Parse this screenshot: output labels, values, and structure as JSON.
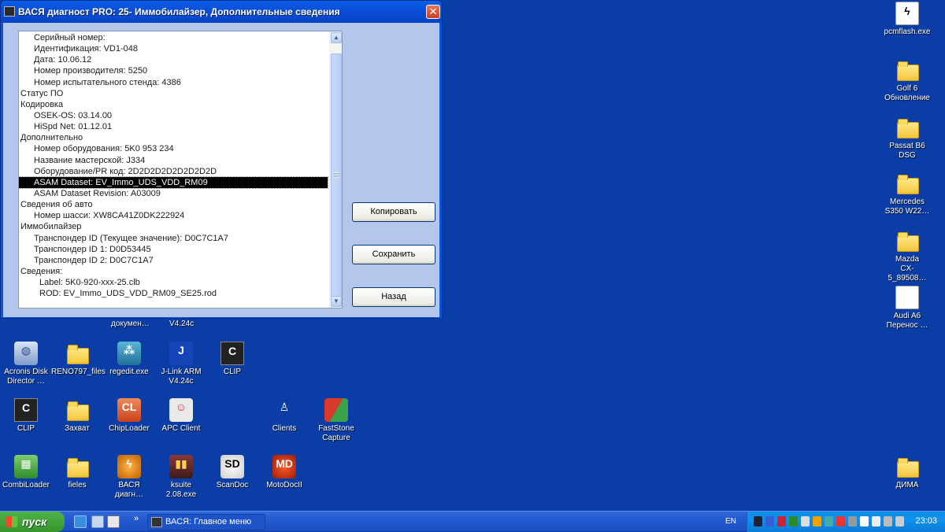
{
  "window": {
    "title": "ВАСЯ диагност PRO: 25- Иммобилайзер,  Дополнительные сведения",
    "close_glyph": "✕",
    "list_items": [
      {
        "text": "Серийный номер:",
        "indent": 1
      },
      {
        "text": "Идентификация: VD1-048",
        "indent": 1
      },
      {
        "text": "Дата: 10.06.12",
        "indent": 1
      },
      {
        "text": "Номер производителя: 5250",
        "indent": 1
      },
      {
        "text": "Номер испытательного стенда: 4386",
        "indent": 1
      },
      {
        "text": "Статус ПО",
        "indent": 0
      },
      {
        "text": "Кодировка",
        "indent": 0
      },
      {
        "text": "OSEK-OS: 03.14.00",
        "indent": 1
      },
      {
        "text": "HiSpd Net: 01.12.01",
        "indent": 1
      },
      {
        "text": "Дополнительно",
        "indent": 0
      },
      {
        "text": "Номер оборудования: 5K0 953 234",
        "indent": 1
      },
      {
        "text": "Название мастерской: J334",
        "indent": 1
      },
      {
        "text": "Оборудование/PR код: 2D2D2D2D2D2D2D2D",
        "indent": 1
      },
      {
        "text": "ASAM Dataset: EV_Immo_UDS_VDD_RM09",
        "indent": 1,
        "selected": true
      },
      {
        "text": "ASAM Dataset Revision: A03009",
        "indent": 1
      },
      {
        "text": "Сведения об авто",
        "indent": 0
      },
      {
        "text": "Номер шасси: XW8CA41Z0DK222924",
        "indent": 1
      },
      {
        "text": "Иммобилайзер",
        "indent": 0
      },
      {
        "text": "Транспондер ID (Текущее значение): D0C7C1A7",
        "indent": 1
      },
      {
        "text": "Транспондер ID 1: D0D53445",
        "indent": 1
      },
      {
        "text": "Транспондер ID 2: D0C7C1A7",
        "indent": 1
      },
      {
        "text": "Сведения:",
        "indent": 0
      },
      {
        "text": "Label: 5K0-920-xxx-25.clb",
        "indent": 2
      },
      {
        "text": "ROD: EV_Immo_UDS_VDD_RM09_SE25.rod",
        "indent": 2
      }
    ],
    "buttons": {
      "copy": "Копировать",
      "save": "Сохранить",
      "back": "Назад"
    }
  },
  "desktop": {
    "partial_labels": {
      "docs": "докумен…",
      "jlink_ver": "V4.24c"
    },
    "right_icons": [
      {
        "label": "pcmflash.exe",
        "icon": "pcmflash-icon"
      },
      {
        "label": "Golf 6\nОбновление",
        "icon": "folder-icon"
      },
      {
        "label": "Passat B6 DSG",
        "icon": "folder-icon"
      },
      {
        "label": "Mercedes\nS350 W22…",
        "icon": "folder-icon"
      },
      {
        "label": "Mazda\nCX-5_89508…",
        "icon": "folder-icon"
      },
      {
        "label": "Audi A6\nПеренос …",
        "icon": "document-icon"
      },
      {
        "label": "ДИМА",
        "icon": "folder-icon"
      }
    ],
    "grid_icons": [
      {
        "label": "Acronis Disk\nDirector …",
        "icon": "acronis-icon"
      },
      {
        "label": "RENO797_files",
        "icon": "folder-icon"
      },
      {
        "label": "regedit.exe",
        "icon": "regedit-icon"
      },
      {
        "label": "J-Link ARM\nV4.24c",
        "icon": "jlink-icon"
      },
      {
        "label": "CLIP",
        "icon": "clip-icon"
      },
      {
        "label": "CLIP",
        "icon": "clip-icon"
      },
      {
        "label": "Захват",
        "icon": "folder-icon"
      },
      {
        "label": "ChipLoader",
        "icon": "chiploader-icon"
      },
      {
        "label": "APC Client",
        "icon": "apc-client-icon"
      },
      {
        "label": "Clients",
        "icon": "clients-icon"
      },
      {
        "label": "FastStone\nCapture",
        "icon": "faststone-icon"
      },
      {
        "label": "CombiLoader",
        "icon": "combiloader-icon"
      },
      {
        "label": "fieles",
        "icon": "folder-icon"
      },
      {
        "label": "ВАСЯ\nдиагн…",
        "icon": "vasya-icon"
      },
      {
        "label": "ksuite\n2.08.exe",
        "icon": "ksuite-icon"
      },
      {
        "label": "ScanDoc",
        "icon": "scandoc-icon"
      },
      {
        "label": "MotoDocII",
        "icon": "motodoc-icon"
      }
    ]
  },
  "taskbar": {
    "start_label": "пуск",
    "active_task": "ВАСЯ:  Главное меню",
    "overflow_glyph": "»",
    "language": "EN",
    "clock": "23:03"
  }
}
